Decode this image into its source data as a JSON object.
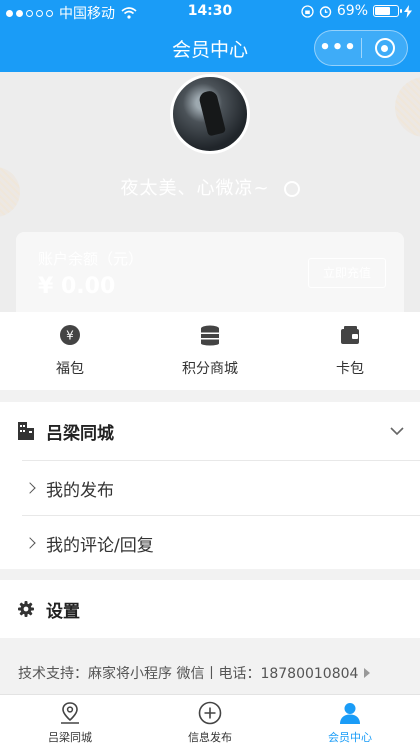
{
  "status_bar": {
    "carrier": "中国移动",
    "time": "14:30",
    "battery": "69%",
    "battery_level": 0.69
  },
  "nav": {
    "title": "会员中心"
  },
  "profile": {
    "username": "夜太美、心微凉~"
  },
  "balance": {
    "label": "账户余额（元）",
    "amount": "¥ 0.00",
    "recharge": "立即充值"
  },
  "quick_menu": [
    {
      "label": "福包",
      "icon": "yen-coin-icon"
    },
    {
      "label": "积分商城",
      "icon": "coin-stack-icon"
    },
    {
      "label": "卡包",
      "icon": "wallet-icon"
    }
  ],
  "section_city": {
    "title": "吕梁同城",
    "items": [
      {
        "label": "我的发布"
      },
      {
        "label": "我的评论/回复"
      }
    ]
  },
  "section_settings": {
    "title": "设置"
  },
  "footer": {
    "text": "技术支持：麻家将小程序 微信丨电话：18780010804"
  },
  "tabbar": [
    {
      "label": "吕梁同城",
      "icon": "map-pin-icon",
      "active": false
    },
    {
      "label": "信息发布",
      "icon": "plus-circle-icon",
      "active": false
    },
    {
      "label": "会员中心",
      "icon": "user-icon",
      "active": true
    }
  ],
  "colors": {
    "primary": "#1a9cf7",
    "header_bg": "#ededed",
    "page_bg": "#f2f2f2"
  }
}
